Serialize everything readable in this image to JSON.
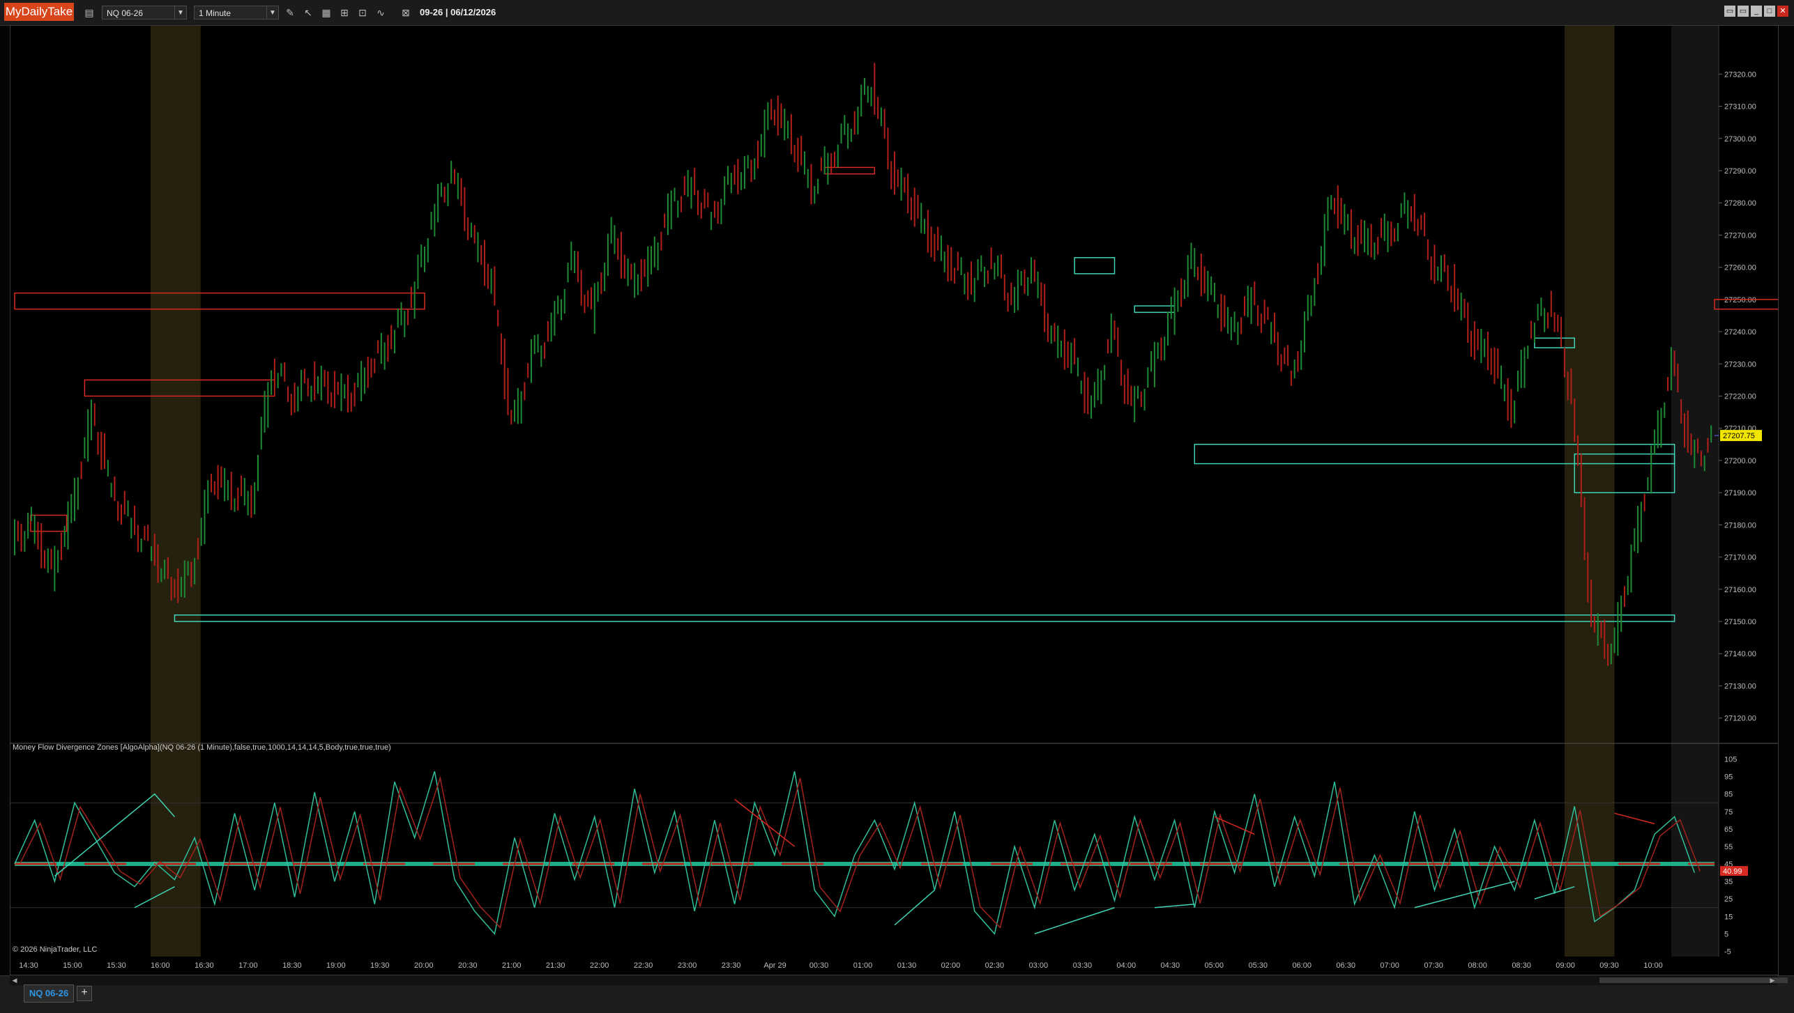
{
  "app": {
    "brand": "MyDailyTake",
    "date_label": "09-26 | 06/12/2026"
  },
  "toolbar": {
    "instrument": "NQ 06-26",
    "interval": "1 Minute",
    "tools": [
      "draw-icon",
      "pointer-icon",
      "data-box-icon",
      "zoom-icon",
      "fit-icon",
      "indicator-icon",
      "strategy-icon"
    ]
  },
  "indicator_label": "Money Flow Divergence Zones [AlgoAlpha](NQ 06-26 (1 Minute),false,true,1000,14,14,14,5,Body,true,true,true)",
  "copyright": "© 2026 NinjaTrader, LLC",
  "tab": {
    "label": "NQ 06-26",
    "add": "+"
  },
  "colors": {
    "bull": "#1e8a34",
    "bear": "#b3201a",
    "zone_green": "#3fd4b5",
    "zone_red": "#d82a20",
    "price_tag": "#f2e600",
    "session": "#2a2410"
  },
  "chart_data": {
    "type": "line",
    "price_axis": {
      "ticks": [
        "27320.00",
        "27310.00",
        "27300.00",
        "27290.00",
        "27280.00",
        "27270.00",
        "27260.00",
        "27250.00",
        "27240.00",
        "27230.00",
        "27220.00",
        "27210.00",
        "27200.00",
        "27190.00",
        "27180.00",
        "27170.00",
        "27160.00",
        "27150.00",
        "27140.00",
        "27130.00",
        "27120.00"
      ],
      "last_price": "27207.75"
    },
    "osc_axis": {
      "ticks": [
        "105",
        "95",
        "85",
        "75",
        "65",
        "55",
        "45",
        "35",
        "25",
        "15",
        "5",
        "-5"
      ],
      "tags": [
        "40.99"
      ]
    },
    "time_axis": [
      "14:30",
      "15:00",
      "15:30",
      "16:00",
      "16:30",
      "17:00",
      "18:30",
      "19:00",
      "19:30",
      "20:00",
      "20:30",
      "21:00",
      "21:30",
      "22:00",
      "22:30",
      "23:00",
      "23:30",
      "Apr 29",
      "00:30",
      "01:00",
      "01:30",
      "02:00",
      "02:30",
      "03:00",
      "03:30",
      "04:00",
      "04:30",
      "05:00",
      "05:30",
      "06:00",
      "06:30",
      "07:00",
      "07:30",
      "08:00",
      "08:30",
      "09:00",
      "09:30",
      "10:00"
    ],
    "price_path": [
      [
        0,
        27175
      ],
      [
        1,
        27180
      ],
      [
        2,
        27165
      ],
      [
        3,
        27185
      ],
      [
        4,
        27215
      ],
      [
        5,
        27190
      ],
      [
        6,
        27180
      ],
      [
        7,
        27172
      ],
      [
        8,
        27160
      ],
      [
        9,
        27165
      ],
      [
        10,
        27195
      ],
      [
        11,
        27190
      ],
      [
        12,
        27188
      ],
      [
        13,
        27230
      ],
      [
        14,
        27220
      ],
      [
        15,
        27225
      ],
      [
        16,
        27222
      ],
      [
        17,
        27220
      ],
      [
        18,
        27230
      ],
      [
        19,
        27238
      ],
      [
        20,
        27250
      ],
      [
        21,
        27275
      ],
      [
        22,
        27290
      ],
      [
        23,
        27270
      ],
      [
        24,
        27255
      ],
      [
        25,
        27210
      ],
      [
        26,
        27232
      ],
      [
        27,
        27240
      ],
      [
        28,
        27262
      ],
      [
        29,
        27245
      ],
      [
        30,
        27270
      ],
      [
        31,
        27255
      ],
      [
        32,
        27262
      ],
      [
        33,
        27280
      ],
      [
        34,
        27285
      ],
      [
        35,
        27275
      ],
      [
        36,
        27288
      ],
      [
        37,
        27290
      ],
      [
        38,
        27310
      ],
      [
        39,
        27300
      ],
      [
        40,
        27285
      ],
      [
        41,
        27295
      ],
      [
        42,
        27305
      ],
      [
        43,
        27318
      ],
      [
        44,
        27290
      ],
      [
        45,
        27280
      ],
      [
        46,
        27268
      ],
      [
        47,
        27260
      ],
      [
        48,
        27255
      ],
      [
        49,
        27262
      ],
      [
        50,
        27250
      ],
      [
        51,
        27260
      ],
      [
        52,
        27238
      ],
      [
        53,
        27232
      ],
      [
        54,
        27215
      ],
      [
        55,
        27240
      ],
      [
        56,
        27215
      ],
      [
        57,
        27228
      ],
      [
        58,
        27245
      ],
      [
        59,
        27262
      ],
      [
        60,
        27252
      ],
      [
        61,
        27240
      ],
      [
        62,
        27250
      ],
      [
        63,
        27240
      ],
      [
        64,
        27225
      ],
      [
        65,
        27250
      ],
      [
        66,
        27282
      ],
      [
        67,
        27270
      ],
      [
        68,
        27268
      ],
      [
        69,
        27272
      ],
      [
        70,
        27280
      ],
      [
        71,
        27262
      ],
      [
        72,
        27255
      ],
      [
        73,
        27238
      ],
      [
        74,
        27232
      ],
      [
        75,
        27215
      ],
      [
        76,
        27242
      ],
      [
        77,
        27248
      ],
      [
        78,
        27220
      ],
      [
        79,
        27150
      ],
      [
        80,
        27140
      ],
      [
        81,
        27170
      ],
      [
        82,
        27200
      ],
      [
        83,
        27230
      ],
      [
        84,
        27200
      ],
      [
        85,
        27205
      ]
    ],
    "red_zones": [
      [
        27252,
        27247,
        0,
        20.5
      ],
      [
        27225,
        27220,
        3.5,
        13
      ],
      [
        27183,
        27178,
        0.8,
        2.6
      ],
      [
        27291,
        27289,
        40.5,
        43
      ],
      [
        27250,
        27247,
        85,
        90
      ]
    ],
    "green_zones": [
      [
        27152,
        27150,
        8,
        83
      ],
      [
        27205,
        27199,
        59,
        83
      ],
      [
        27202,
        27190,
        78,
        83
      ],
      [
        27238,
        27235,
        76,
        78
      ],
      [
        27263,
        27258,
        53,
        55
      ],
      [
        27248,
        27246,
        56,
        58
      ]
    ],
    "osc_path": [
      [
        0,
        45
      ],
      [
        1,
        70
      ],
      [
        2,
        35
      ],
      [
        3,
        80
      ],
      [
        4,
        60
      ],
      [
        5,
        40
      ],
      [
        6,
        32
      ],
      [
        7,
        46
      ],
      [
        8,
        36
      ],
      [
        9,
        60
      ],
      [
        10,
        22
      ],
      [
        11,
        74
      ],
      [
        12,
        30
      ],
      [
        13,
        80
      ],
      [
        14,
        26
      ],
      [
        15,
        86
      ],
      [
        16,
        35
      ],
      [
        17,
        75
      ],
      [
        18,
        22
      ],
      [
        19,
        92
      ],
      [
        20,
        60
      ],
      [
        21,
        98
      ],
      [
        22,
        36
      ],
      [
        23,
        18
      ],
      [
        24,
        5
      ],
      [
        25,
        60
      ],
      [
        26,
        20
      ],
      [
        27,
        74
      ],
      [
        28,
        36
      ],
      [
        29,
        72
      ],
      [
        30,
        20
      ],
      [
        31,
        88
      ],
      [
        32,
        40
      ],
      [
        33,
        75
      ],
      [
        34,
        18
      ],
      [
        35,
        70
      ],
      [
        36,
        22
      ],
      [
        37,
        80
      ],
      [
        38,
        50
      ],
      [
        39,
        98
      ],
      [
        40,
        30
      ],
      [
        41,
        15
      ],
      [
        42,
        50
      ],
      [
        43,
        70
      ],
      [
        44,
        42
      ],
      [
        45,
        80
      ],
      [
        46,
        30
      ],
      [
        47,
        75
      ],
      [
        48,
        18
      ],
      [
        49,
        5
      ],
      [
        50,
        55
      ],
      [
        51,
        20
      ],
      [
        52,
        70
      ],
      [
        53,
        30
      ],
      [
        54,
        62
      ],
      [
        55,
        24
      ],
      [
        56,
        72
      ],
      [
        57,
        36
      ],
      [
        58,
        70
      ],
      [
        59,
        20
      ],
      [
        60,
        75
      ],
      [
        61,
        40
      ],
      [
        62,
        85
      ],
      [
        63,
        32
      ],
      [
        64,
        72
      ],
      [
        65,
        38
      ],
      [
        66,
        92
      ],
      [
        67,
        22
      ],
      [
        68,
        50
      ],
      [
        69,
        20
      ],
      [
        70,
        75
      ],
      [
        71,
        30
      ],
      [
        72,
        65
      ],
      [
        73,
        20
      ],
      [
        74,
        55
      ],
      [
        75,
        30
      ],
      [
        76,
        70
      ],
      [
        77,
        28
      ],
      [
        78,
        78
      ],
      [
        79,
        12
      ],
      [
        80,
        20
      ],
      [
        81,
        30
      ],
      [
        82,
        62
      ],
      [
        83,
        72
      ],
      [
        84,
        40
      ]
    ],
    "osc_divergence_lines": [
      [
        [
          2,
          38
        ],
        [
          7,
          85
        ],
        [
          8,
          72
        ]
      ],
      [
        [
          6,
          20
        ],
        [
          8,
          32
        ]
      ],
      [
        [
          36,
          82
        ],
        [
          39,
          55
        ]
      ],
      [
        [
          44,
          10
        ],
        [
          46,
          30
        ]
      ],
      [
        [
          51,
          5
        ],
        [
          55,
          20
        ]
      ],
      [
        [
          57,
          20
        ],
        [
          59,
          22
        ]
      ],
      [
        [
          60,
          72
        ],
        [
          62,
          62
        ]
      ],
      [
        [
          70,
          20
        ],
        [
          75,
          35
        ]
      ],
      [
        [
          76,
          25
        ],
        [
          78,
          32
        ]
      ],
      [
        [
          80,
          74
        ],
        [
          82,
          68
        ]
      ]
    ]
  }
}
